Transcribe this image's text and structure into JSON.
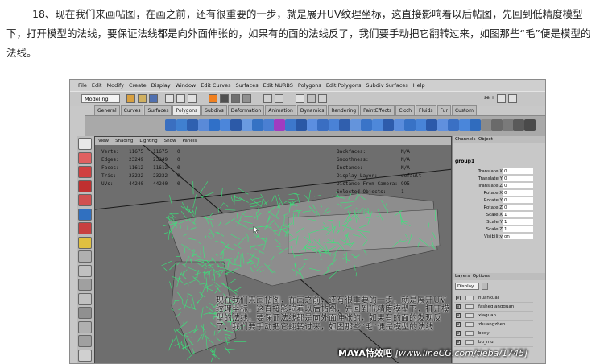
{
  "article": {
    "paragraph": "18、现在我们来画帖图，在画之前，还有很重要的一步，就是展开UV纹理坐标，这直接影响着以后帖图，先回到低精度模型下，打开模型的法线，要保证法线都是向外面伸张的，如果有的面的法线反了，我们要手动把它翻转过来，如图那些“毛”便是模型的法线。"
  },
  "menubar": [
    "File",
    "Edit",
    "Modify",
    "Create",
    "Display",
    "Window",
    "Edit Curves",
    "Surfaces",
    "Edit NURBS",
    "Polygons",
    "Edit Polygons",
    "Subdiv Surfaces",
    "Help"
  ],
  "status_line": {
    "mode": "Modeling",
    "select_label": "sel+"
  },
  "shelf_tabs": [
    "General",
    "Curves",
    "Surfaces",
    "Polygons",
    "Subdivs",
    "Deformation",
    "Animation",
    "Dynamics",
    "Rendering",
    "PaintEffects",
    "Cloth",
    "Fluids",
    "Fur",
    "Custom"
  ],
  "shelf_active_tab": "Polygons",
  "viewport": {
    "menu": [
      "View",
      "Shading",
      "Lighting",
      "Show",
      "Panels"
    ],
    "hud_left": [
      {
        "label": "Verts:",
        "a": "11675",
        "b": "11675",
        "c": "0"
      },
      {
        "label": "Edges:",
        "a": "23249",
        "b": "23249",
        "c": "0"
      },
      {
        "label": "Faces:",
        "a": "11612",
        "b": "11612",
        "c": "0"
      },
      {
        "label": "Tris:",
        "a": "23232",
        "b": "23232",
        "c": "0"
      },
      {
        "label": "UVs:",
        "a": "44240",
        "b": "44240",
        "c": "0"
      }
    ],
    "hud_right": [
      {
        "label": "Backfaces:",
        "value": "N/A"
      },
      {
        "label": "Smoothness:",
        "value": "N/A"
      },
      {
        "label": "Instance:",
        "value": "N/A"
      },
      {
        "label": "Display Layer:",
        "value": "default"
      },
      {
        "label": "Distance From Camera:",
        "value": "995"
      },
      {
        "label": "Selected Objects:",
        "value": "1"
      }
    ],
    "overlay_text": "现在我们来画帖图，在画之前，还有很重要的一步，就是展开UV纹理坐标，这直接影响着以后帖图，先回到低精度模型下，打开模型的法线，要保证法线都是向外面伸张的，如果有的面的发现反了，我们要手动把它翻转过来，如图那些“毛”便是模型的法线"
  },
  "channel_box": {
    "menu": [
      "Channels",
      "Object"
    ],
    "object_name": "group1",
    "channels": [
      {
        "name": "Translate X",
        "value": "0"
      },
      {
        "name": "Translate Y",
        "value": "0"
      },
      {
        "name": "Translate Z",
        "value": "0"
      },
      {
        "name": "Rotate X",
        "value": "0"
      },
      {
        "name": "Rotate Y",
        "value": "0"
      },
      {
        "name": "Rotate Z",
        "value": "0"
      },
      {
        "name": "Scale X",
        "value": "1"
      },
      {
        "name": "Scale Y",
        "value": "1"
      },
      {
        "name": "Scale Z",
        "value": "1"
      },
      {
        "name": "Visibility",
        "value": "on"
      }
    ]
  },
  "layer_editor": {
    "menu": [
      "Layers",
      "Options"
    ],
    "display_value": "Display",
    "layers": [
      {
        "visible": "V",
        "name": "huankuai"
      },
      {
        "visible": "V",
        "name": "fashegiangguan"
      },
      {
        "visible": "V",
        "name": "xiaguan"
      },
      {
        "visible": "V",
        "name": "zhuangzhen"
      },
      {
        "visible": "V",
        "name": "body"
      },
      {
        "visible": "V",
        "name": "bu_mu"
      }
    ]
  },
  "watermark": {
    "brand": "MAYA特效吧",
    "url": "[www.lineCG.com/tieba/1745]"
  },
  "colors": {
    "normals": "#37e87a",
    "viewport_bg": "#6e6e6e",
    "ui_gray": "#c8c8c8"
  }
}
